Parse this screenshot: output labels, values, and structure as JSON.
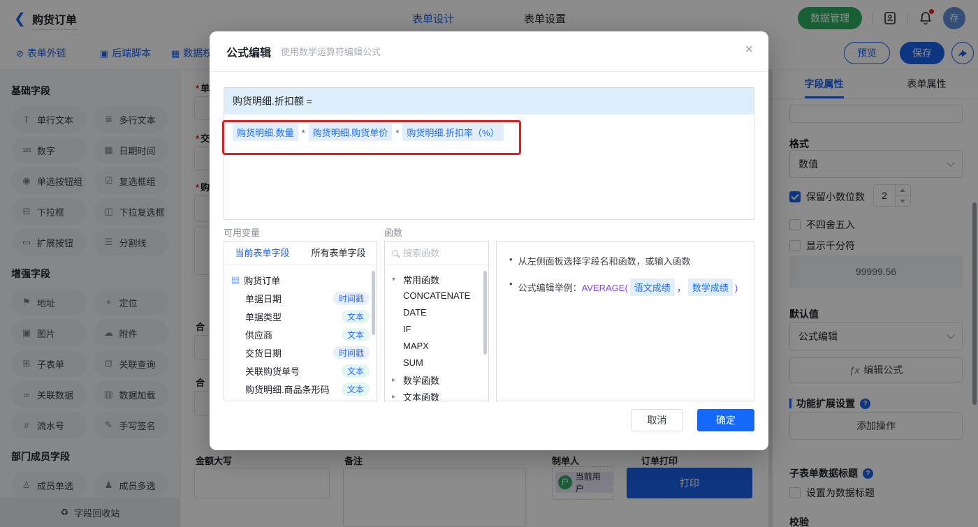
{
  "colors": {
    "accent_blue": "#1b62e8",
    "confirm_blue": "#1569f6",
    "green": "#2fae63",
    "annotation_red": "#e01e1e",
    "chip_bg": "#e2eefc",
    "chip_text": "#1f6ef4",
    "badge_time_bg": "#e9effd",
    "badge_text_bg": "#e3f6ef",
    "badge_fg": "#2f6bff",
    "header_bar_bg": "#dfeefb",
    "user_chip_bg": "#eae6f7",
    "avatar_green": "#2eac64"
  },
  "topbar": {
    "title": "购货订单",
    "back_glyph": "❮",
    "tab_design": "表单设计",
    "tab_settings": "表单设置",
    "data_manage": "数据管理",
    "avatar_text": "存"
  },
  "toolbar": {
    "link_external": "表单外链",
    "link_script": "后端脚本",
    "link_permission": "数据权",
    "preview": "预览",
    "save": "保存"
  },
  "sidebar": {
    "sections": [
      {
        "title": "基础字段",
        "items": [
          {
            "icon": "single-line-text-icon",
            "glyph": "T",
            "label": "单行文本"
          },
          {
            "icon": "multi-line-text-icon",
            "glyph": "≣",
            "label": "多行文本"
          },
          {
            "icon": "number-icon",
            "glyph": "123",
            "label": "数字"
          },
          {
            "icon": "datetime-icon",
            "glyph": "▦",
            "label": "日期时间"
          },
          {
            "icon": "radio-group-icon",
            "glyph": "◉",
            "label": "单选按钮组"
          },
          {
            "icon": "checkbox-group-icon",
            "glyph": "☑",
            "label": "复选框组"
          },
          {
            "icon": "dropdown-icon",
            "glyph": "⊟",
            "label": "下拉框"
          },
          {
            "icon": "dropdown-multi-icon",
            "glyph": "◫",
            "label": "下拉复选框"
          },
          {
            "icon": "extend-button-icon",
            "glyph": "▭",
            "label": "扩展按钮"
          },
          {
            "icon": "divider-icon",
            "glyph": "☰",
            "label": "分割线"
          }
        ]
      },
      {
        "title": "增强字段",
        "items": [
          {
            "icon": "address-icon",
            "glyph": "⚑",
            "label": "地址"
          },
          {
            "icon": "location-icon",
            "glyph": "⌖",
            "label": "定位"
          },
          {
            "icon": "image-icon",
            "glyph": "▣",
            "label": "图片"
          },
          {
            "icon": "attachment-icon",
            "glyph": "☁",
            "label": "附件"
          },
          {
            "icon": "subform-icon",
            "glyph": "⊞",
            "label": "子表单"
          },
          {
            "icon": "lookup-query-icon",
            "glyph": "⊡",
            "label": "关联查询"
          },
          {
            "icon": "linked-data-icon",
            "glyph": "∞",
            "label": "关联数据"
          },
          {
            "icon": "data-load-icon",
            "glyph": "▥",
            "label": "数据加载"
          },
          {
            "icon": "serial-number-icon",
            "glyph": "#",
            "label": "流水号"
          },
          {
            "icon": "signature-icon",
            "glyph": "✎",
            "label": "手写签名"
          }
        ]
      },
      {
        "title": "部门成员字段",
        "items": [
          {
            "icon": "member-single-icon",
            "glyph": "♙",
            "label": "成员单选"
          },
          {
            "icon": "member-multi-icon",
            "glyph": "♟",
            "label": "成员多选"
          }
        ]
      }
    ],
    "recycle": "字段回收站",
    "recycle_glyph": "♻"
  },
  "canvas": {
    "star": "*",
    "partial_labels": [
      {
        "required": true,
        "text": "单"
      },
      {
        "required": true,
        "text": "交"
      },
      {
        "required": true,
        "text": "购"
      },
      {
        "required": false,
        "text": "合"
      },
      {
        "required": false,
        "text": "合"
      }
    ],
    "amount_label": "金额大写",
    "remark_label": "备注",
    "creator_label": "制单人",
    "creator_chip": "当前用户",
    "creator_chip_icon": "户",
    "print_label": "订单打印",
    "print_button": "打印"
  },
  "modal": {
    "title": "公式编辑",
    "subtitle": "使用数学运算符编辑公式",
    "close_glyph": "×",
    "formula_target": "购货明细.折扣额 =",
    "operator": "*",
    "formula_tokens": [
      "购货明细.数量",
      "购货明细.购货单价",
      "购货明细.折扣率（%）"
    ],
    "variables": {
      "label": "可用变量",
      "tab_current": "当前表单字段",
      "tab_all": "所有表单字段",
      "root": "购货订单",
      "fields": [
        {
          "name": "单据日期",
          "type": "时间戳"
        },
        {
          "name": "单据类型",
          "type": "文本"
        },
        {
          "name": "供应商",
          "type": "文本"
        },
        {
          "name": "交货日期",
          "type": "时间戳"
        },
        {
          "name": "关联购货单号",
          "type": "文本"
        },
        {
          "name": "购货明细.商品条形码",
          "type": "文本"
        }
      ]
    },
    "functions": {
      "label": "函数",
      "search_placeholder": "搜索函数",
      "groups": [
        {
          "name": "常用函数",
          "expanded": true,
          "items": [
            "CONCATENATE",
            "DATE",
            "IF",
            "MAPX",
            "SUM"
          ]
        },
        {
          "name": "数学函数",
          "expanded": false,
          "items": []
        },
        {
          "name": "文本函数",
          "expanded": false,
          "items": []
        }
      ]
    },
    "tips": {
      "line1": "从左侧面板选择字段名和函数，或输入函数",
      "line2_prefix": "公式编辑举例：",
      "line2_fn": "AVERAGE(",
      "args": [
        "语文成绩",
        "数学成绩"
      ],
      "comma": "，",
      "close_paren": ")"
    },
    "cancel": "取消",
    "confirm": "确定"
  },
  "rightbar": {
    "tab_field": "字段属性",
    "tab_form": "表单属性",
    "format_label": "格式",
    "format_value": "数值",
    "cb_decimal": "保留小数位数",
    "decimal_value": "2",
    "cb_no_round": "不四舍五入",
    "cb_thousands": "显示千分符",
    "preview_value": "99999.56",
    "default_label": "默认值",
    "default_value": "公式编辑",
    "fx_glyph": "ƒx",
    "edit_formula": "编辑公式",
    "ext_title": "功能扩展设置",
    "help_glyph": "?",
    "add_action": "添加操作",
    "subform_title": "子表单数据标题",
    "cb_data_title": "设置为数据标题",
    "validation_label": "校验"
  }
}
